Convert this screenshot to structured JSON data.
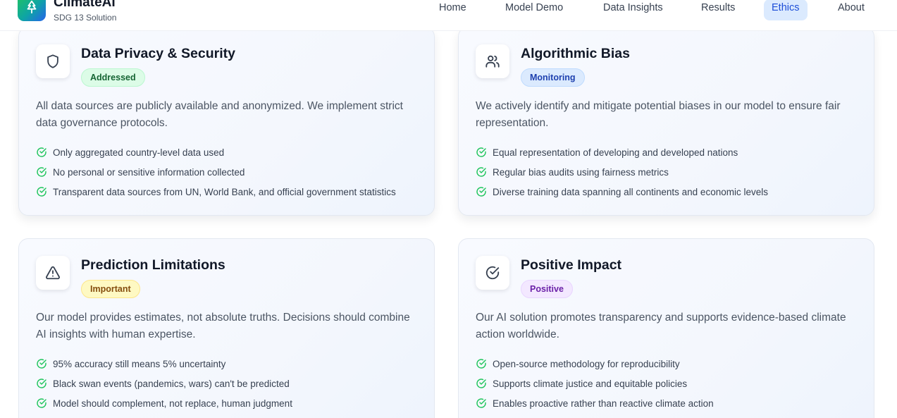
{
  "header": {
    "brand_title": "ClimateAI",
    "brand_subtitle": "SDG 13 Solution",
    "logo_icon": "tree-icon",
    "nav": [
      {
        "label": "Home",
        "active": false
      },
      {
        "label": "Model Demo",
        "active": false
      },
      {
        "label": "Data Insights",
        "active": false
      },
      {
        "label": "Results",
        "active": false
      },
      {
        "label": "Ethics",
        "active": true
      },
      {
        "label": "About",
        "active": false
      }
    ]
  },
  "colors": {
    "accent_blue": "#1d4ed8",
    "check_green": "#22c55e",
    "logo_gradient": [
      "#22c55e",
      "#0ea5a4",
      "#2563eb"
    ]
  },
  "cards": [
    {
      "icon": "shield-icon",
      "title": "Data Privacy & Security",
      "badge": "Addressed",
      "badge_tone": "green",
      "description": "All data sources are publicly available and anonymized. We implement strict data governance protocols.",
      "points": [
        "Only aggregated country-level data used",
        "No personal or sensitive information collected",
        "Transparent data sources from UN, World Bank, and official government statistics"
      ]
    },
    {
      "icon": "users-icon",
      "title": "Algorithmic Bias",
      "badge": "Monitoring",
      "badge_tone": "blue",
      "description": "We actively identify and mitigate potential biases in our model to ensure fair representation.",
      "points": [
        "Equal representation of developing and developed nations",
        "Regular bias audits using fairness metrics",
        "Diverse training data spanning all continents and economic levels"
      ]
    },
    {
      "icon": "warning-triangle-icon",
      "title": "Prediction Limitations",
      "badge": "Important",
      "badge_tone": "yellow",
      "description": "Our model provides estimates, not absolute truths. Decisions should combine AI insights with human expertise.",
      "points": [
        "95% accuracy still means 5% uncertainty",
        "Black swan events (pandemics, wars) can't be predicted",
        "Model should complement, not replace, human judgment"
      ]
    },
    {
      "icon": "check-circle-icon",
      "title": "Positive Impact",
      "badge": "Positive",
      "badge_tone": "purple",
      "description": "Our AI solution promotes transparency and supports evidence-based climate action worldwide.",
      "points": [
        "Open-source methodology for reproducibility",
        "Supports climate justice and equitable policies",
        "Enables proactive rather than reactive climate action"
      ]
    }
  ]
}
